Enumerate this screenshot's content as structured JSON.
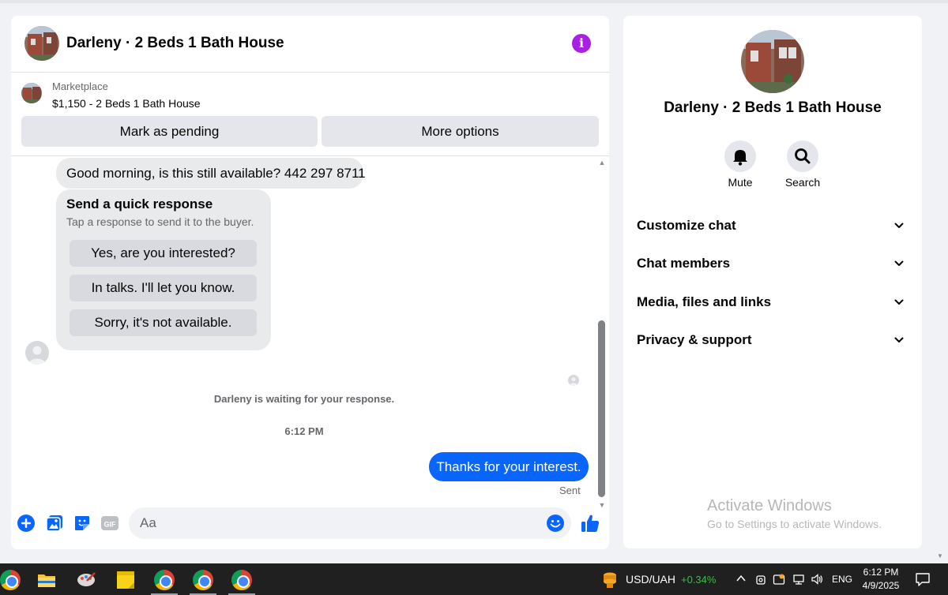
{
  "conversation": {
    "title": "Darleny · 2 Beds 1 Bath House"
  },
  "marketplace": {
    "label": "Marketplace",
    "listing": "$1,150 - 2 Beds 1 Bath House",
    "mark_pending_label": "Mark as pending",
    "more_options_label": "More options"
  },
  "messages": {
    "incoming_first": "Good morning, is this still available? 442 297 8711",
    "quick_response": {
      "title": "Send a quick response",
      "subtitle": "Tap a response to send it to the buyer.",
      "options": [
        "Yes, are you interested?",
        "In talks. I'll let you know.",
        "Sorry, it's not available."
      ]
    },
    "waiting_notice": "Darleny is waiting for your response.",
    "timestamp": "6:12 PM",
    "outgoing": "Thanks for your interest.",
    "sent_status": "Sent"
  },
  "composer": {
    "placeholder": "Aa",
    "icons": [
      "plus-icon",
      "photo-icon",
      "sticker-icon",
      "gif-icon",
      "emoji-icon",
      "like-icon"
    ],
    "gif_label": "GIF"
  },
  "info_panel": {
    "title": "Darleny · 2 Beds 1 Bath House",
    "actions": [
      {
        "label": "Mute",
        "icon": "bell-icon"
      },
      {
        "label": "Search",
        "icon": "search-icon"
      }
    ],
    "sections": [
      "Customize chat",
      "Chat members",
      "Media, files and links",
      "Privacy & support"
    ]
  },
  "watermark": {
    "line1": "Activate Windows",
    "line2": "Go to Settings to activate Windows."
  },
  "taskbar": {
    "ticker_name": "USD/UAH",
    "ticker_change": "+0.34%",
    "language": "ENG",
    "time": "6:12 PM",
    "date": "4/9/2025"
  },
  "colors": {
    "accent_blue": "#0866ff",
    "info_purple": "#a91fe3",
    "ticker_green": "#3fb950"
  }
}
